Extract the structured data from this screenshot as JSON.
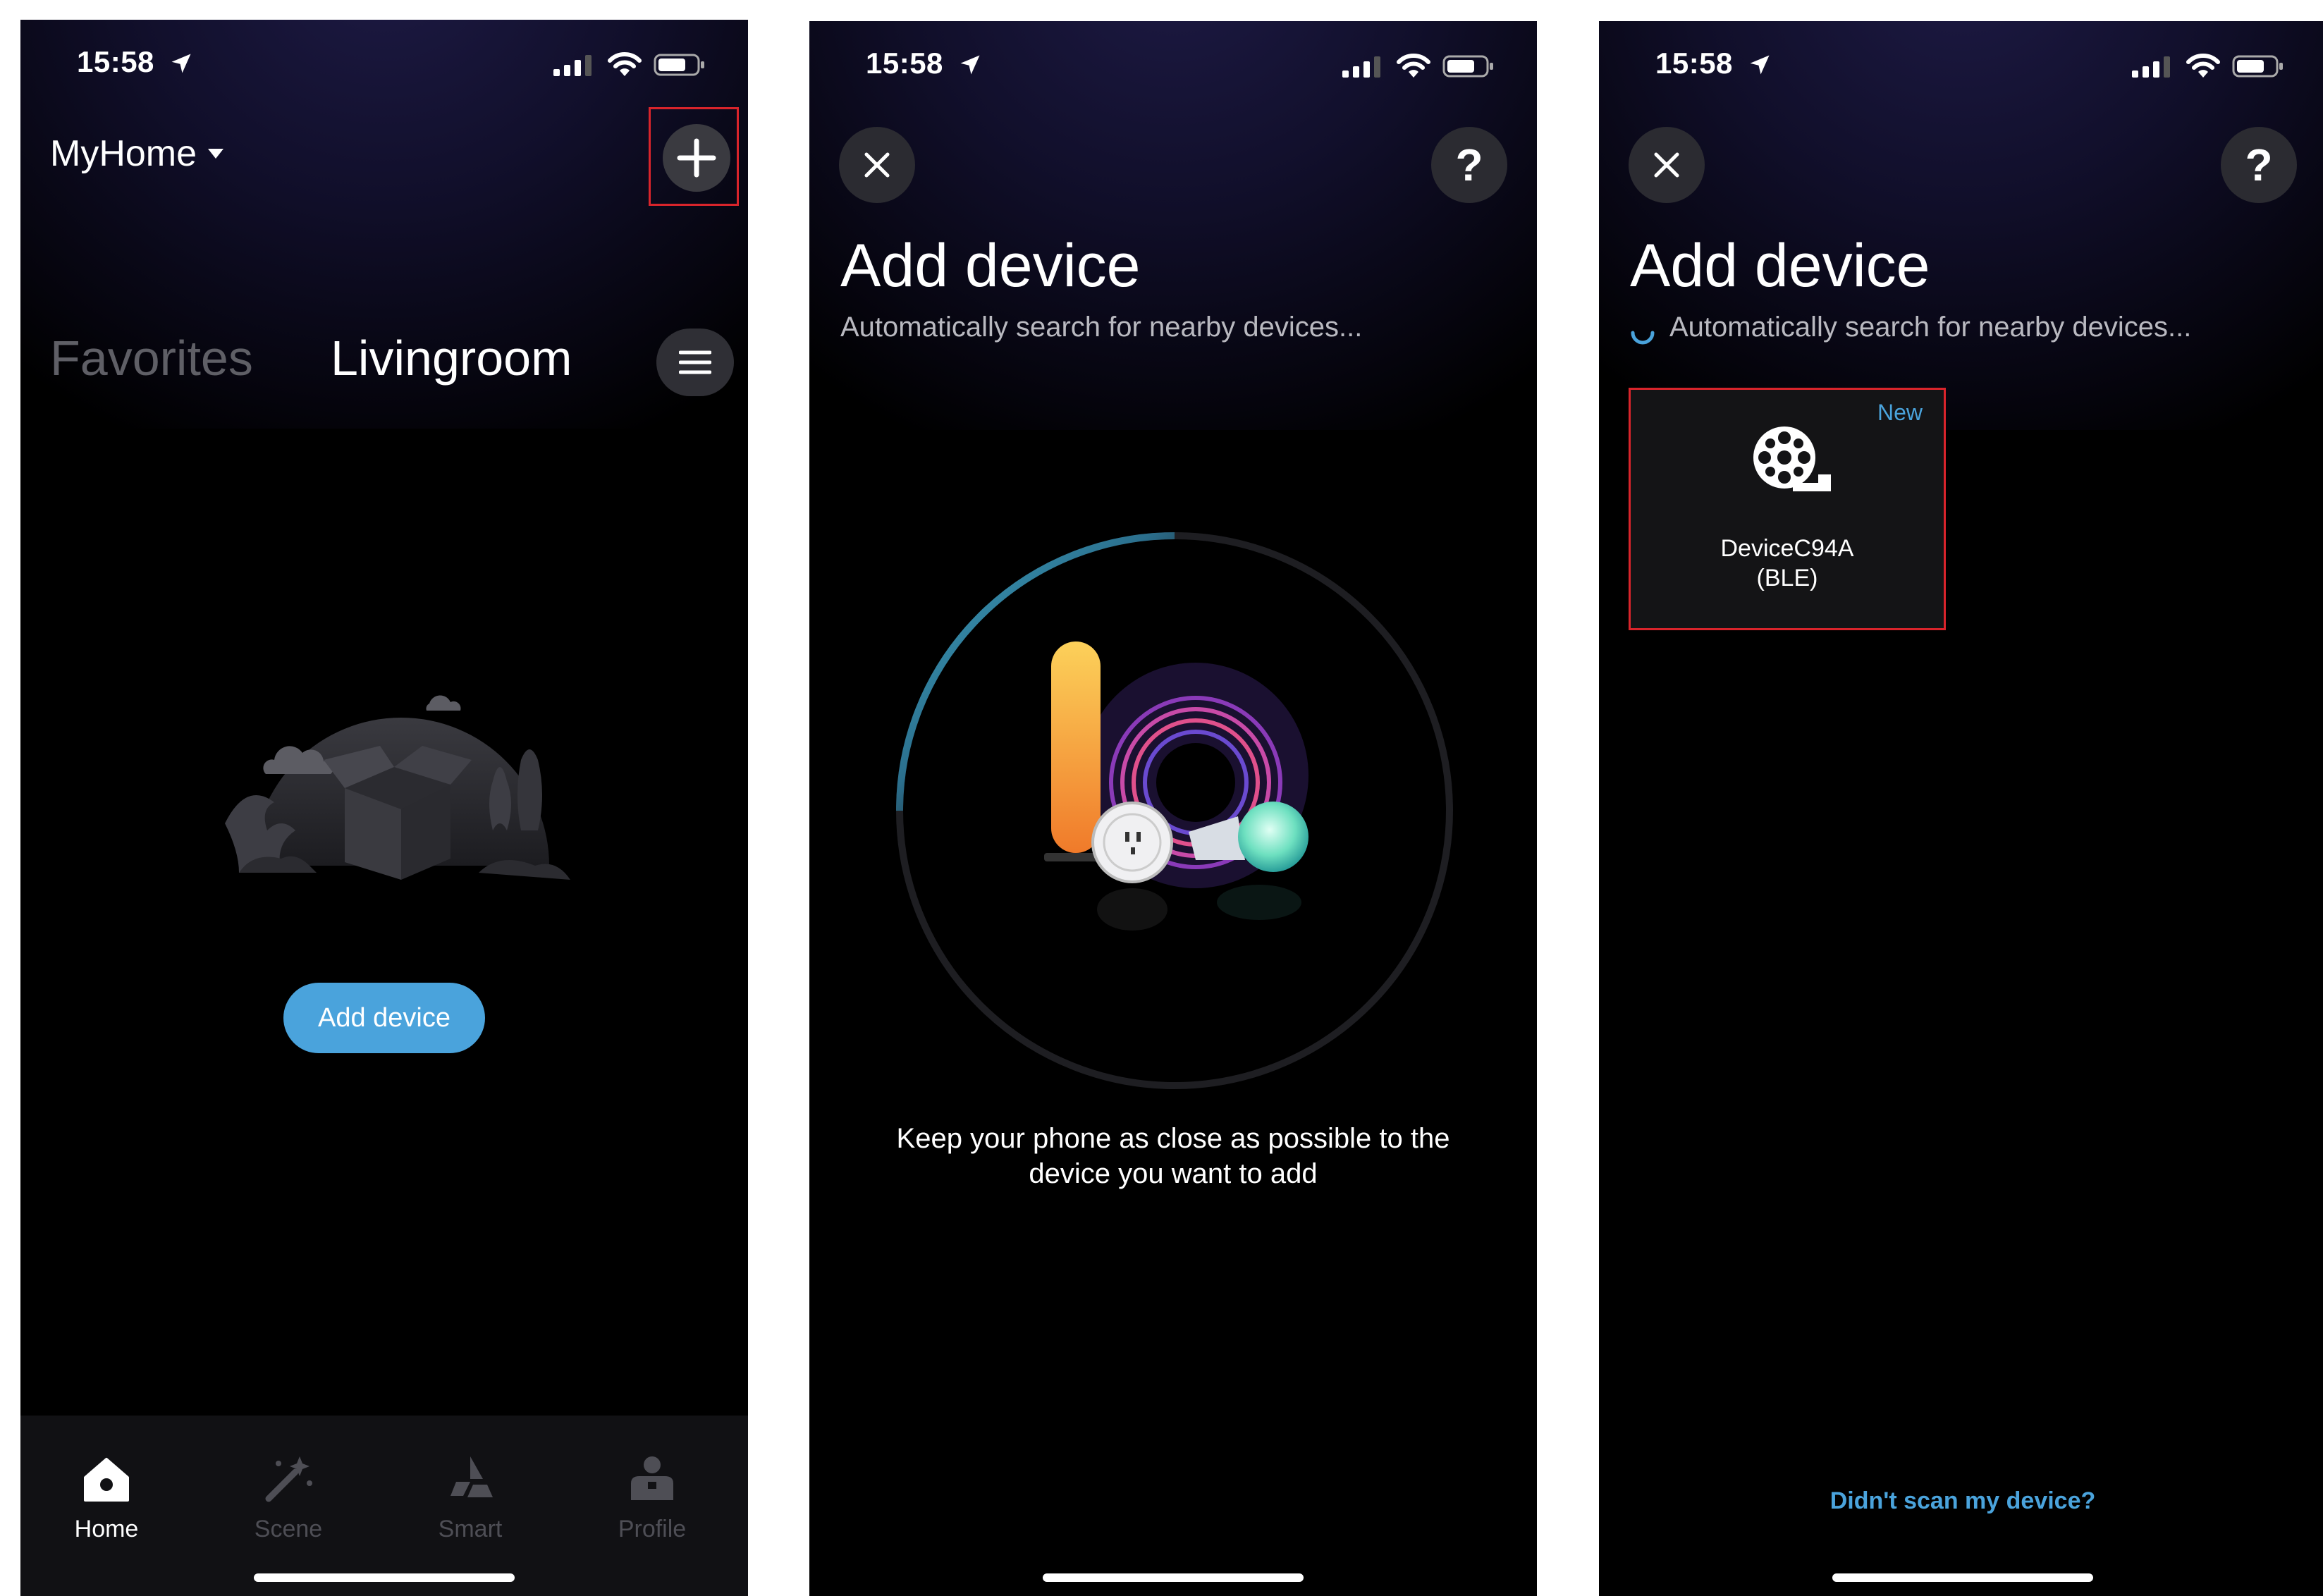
{
  "status_bar": {
    "time": "15:58"
  },
  "screens": [
    {
      "home_name": "MyHome",
      "tabs": [
        "Favorites",
        "Livingroom"
      ],
      "add_device_label": "Add device",
      "tabbar": [
        {
          "label": "Home",
          "icon": "home-icon",
          "active": true
        },
        {
          "label": "Scene",
          "icon": "magic-wand-icon",
          "active": false
        },
        {
          "label": "Smart",
          "icon": "smart-icon",
          "active": false
        },
        {
          "label": "Profile",
          "icon": "profile-icon",
          "active": false
        }
      ]
    },
    {
      "title": "Add device",
      "subtitle": "Automatically search for nearby devices...",
      "hint_line1": "Keep your phone as close as possible to the",
      "hint_line2": "device you want to add"
    },
    {
      "title": "Add device",
      "subtitle": "Automatically search for nearby devices...",
      "device": {
        "badge": "New",
        "name": "DeviceC94A",
        "protocol": "(BLE)",
        "icon": "device-reel-icon"
      },
      "help_link": "Didn't scan my device?"
    }
  ],
  "colors": {
    "accent": "#4aa3dc",
    "highlight": "#d9242b",
    "background": "#000000",
    "inactive_text": "#5f5f66"
  }
}
